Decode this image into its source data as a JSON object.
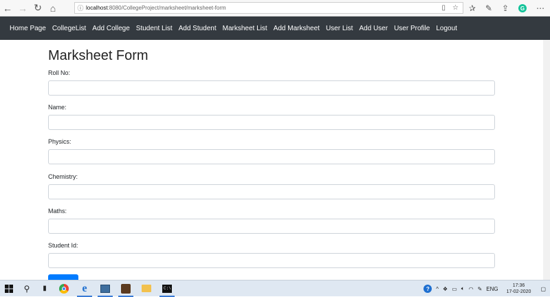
{
  "browser": {
    "url_host": "localhost",
    "url_path": ":8080/CollegeProject/marksheet/marksheet-form",
    "icons": {
      "back": "back-arrow-icon",
      "forward": "forward-arrow-icon",
      "refresh": "refresh-icon",
      "home": "home-icon",
      "info": "info-icon",
      "reading_view": "reading-view-icon",
      "favorite": "star-icon",
      "favorites_bar": "favorites-icon",
      "notes": "pen-icon",
      "share": "share-icon",
      "extension": "grammarly-icon",
      "menu": "more-icon"
    }
  },
  "navbar": {
    "links": [
      "Home Page",
      "CollegeList",
      "Add College",
      "Student List",
      "Add Student",
      "Marksheet List",
      "Add Marksheet",
      "User List",
      "Add User",
      "User Profile",
      "Logout"
    ],
    "bg_color": "#343a40"
  },
  "form": {
    "title": "Marksheet Form",
    "fields": [
      {
        "label": "Roll No:",
        "value": ""
      },
      {
        "label": "Name:",
        "value": ""
      },
      {
        "label": "Physics:",
        "value": ""
      },
      {
        "label": "Chemistry:",
        "value": ""
      },
      {
        "label": "Maths:",
        "value": ""
      },
      {
        "label": "Student Id:",
        "value": ""
      }
    ],
    "submit_color": "#007bff"
  },
  "taskbar": {
    "language": "ENG",
    "time": "17:36",
    "date": "17-02-2020",
    "apps": [
      "chrome",
      "edge",
      "app-window",
      "rose-app",
      "file-explorer",
      "command-prompt"
    ]
  }
}
